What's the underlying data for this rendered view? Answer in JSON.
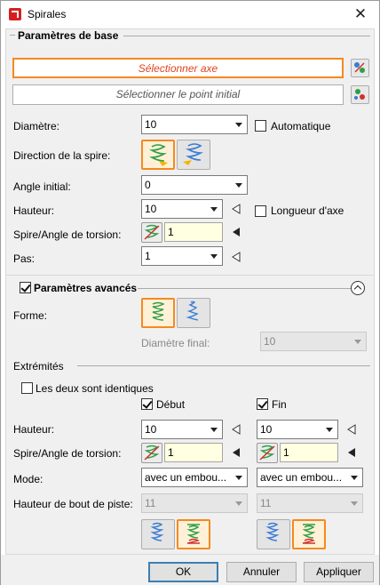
{
  "window": {
    "title": "Spirales",
    "close_glyph": "✕"
  },
  "basic": {
    "section_title": "Paramètres de base",
    "select_axis": "Sélectionner axe",
    "select_start_point": "Sélectionner le point initial",
    "diameter_label": "Diamètre:",
    "diameter_value": "10",
    "automatic_label": "Automatique",
    "automatic_checked": false,
    "direction_label": "Direction de la spire:",
    "start_angle_label": "Angle initial:",
    "start_angle_value": "0",
    "height_label": "Hauteur:",
    "height_value": "10",
    "axis_length_label": "Longueur d'axe",
    "axis_length_checked": false,
    "turns_label": "Spire/Angle de torsion:",
    "turns_value": "1",
    "pitch_label": "Pas:",
    "pitch_value": "1"
  },
  "advanced": {
    "section_title": "Paramètres avancés",
    "checked": true,
    "shape_label": "Forme:",
    "final_diameter_label": "Diamètre final:",
    "final_diameter_value": "10"
  },
  "ends": {
    "section_title": "Extrémités",
    "identical_label": "Les deux sont identiques",
    "identical_checked": false,
    "start_label": "Début",
    "start_checked": true,
    "end_label": "Fin",
    "end_checked": true,
    "height_label": "Hauteur:",
    "start_height": "10",
    "end_height": "10",
    "turns_label": "Spire/Angle de torsion:",
    "start_turns": "1",
    "end_turns": "1",
    "mode_label": "Mode:",
    "start_mode": "avec un embou...",
    "end_mode": "avec un embou...",
    "tip_height_label": "Hauteur de bout de piste:",
    "start_tip_height": "11",
    "end_tip_height": "11"
  },
  "footer": {
    "ok": "OK",
    "cancel": "Annuler",
    "apply": "Appliquer"
  },
  "colors": {
    "accent_orange": "#f5891f",
    "select_text": "#e0441d",
    "input_yellow": "#ffffe1"
  }
}
